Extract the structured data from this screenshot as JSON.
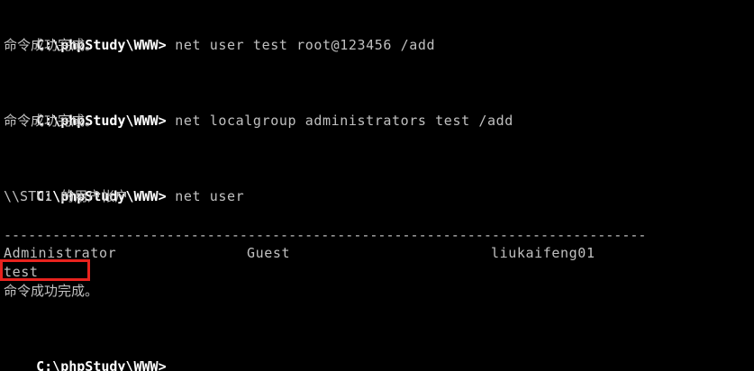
{
  "terminal": {
    "prompt": "C:\\phpStudy\\WWW>",
    "commands": [
      {
        "text": " net user test root@123456 /add",
        "output": "命令成功完成。"
      },
      {
        "text": " net localgroup administrators test /add",
        "output": "命令成功完成。"
      },
      {
        "text": " net user",
        "output": "\\\\STU1 的用户帐户"
      }
    ],
    "separator": "-------------------------------------------------------------------------------",
    "accounts": [
      "Administrator",
      "Guest",
      "liukaifeng01",
      "test"
    ],
    "final_output": "命令成功完成。",
    "highlight_color": "#e8231e"
  }
}
